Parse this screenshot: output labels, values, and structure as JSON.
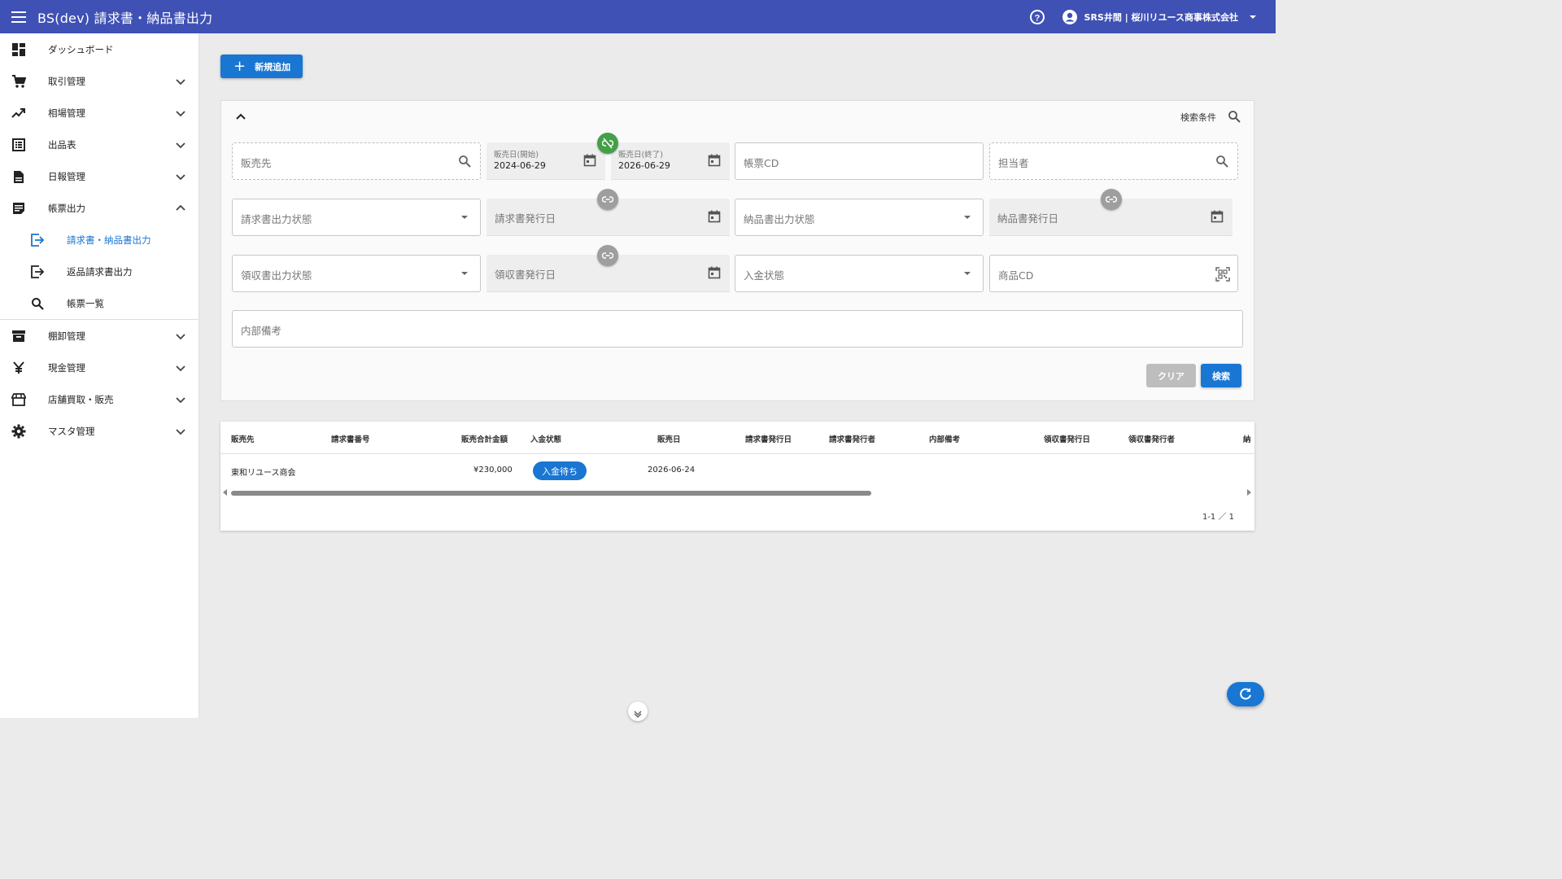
{
  "header": {
    "title": "BS(dev) 請求書・納品書出力",
    "user": "SRS井間 | 桜川リユース商事株式会社"
  },
  "sidebar": {
    "items": [
      {
        "label": "ダッシュボード",
        "icon": "dashboard-icon"
      },
      {
        "label": "取引管理",
        "icon": "cart-icon"
      },
      {
        "label": "相場管理",
        "icon": "trending-up-icon"
      },
      {
        "label": "出品表",
        "icon": "list-icon"
      },
      {
        "label": "日報管理",
        "icon": "document-icon"
      },
      {
        "label": "帳票出力",
        "icon": "form-icon"
      },
      {
        "label": "棚卸管理",
        "icon": "archive-icon"
      },
      {
        "label": "現金管理",
        "icon": "yen-icon"
      },
      {
        "label": "店舗買取・販売",
        "icon": "store-icon"
      },
      {
        "label": "マスタ管理",
        "icon": "gear-icon"
      }
    ],
    "subitems": [
      {
        "label": "請求書・納品書出力",
        "icon": "export-icon"
      },
      {
        "label": "返品請求書出力",
        "icon": "export-icon"
      },
      {
        "label": "帳票一覧",
        "icon": "search-icon"
      }
    ]
  },
  "toolbar": {
    "add_label": "新規追加"
  },
  "search": {
    "condition_label": "検索条件",
    "customer_placeholder": "販売先",
    "sale_date_start_label": "販売日(開始)",
    "sale_date_start_value": "2024-06-29",
    "sale_date_end_label": "販売日(終了)",
    "sale_date_end_value": "2026-06-29",
    "form_cd_placeholder": "帳票CD",
    "staff_placeholder": "担当者",
    "invoice_status_placeholder": "請求書出力状態",
    "invoice_issue_date_placeholder": "請求書発行日",
    "delivery_status_placeholder": "納品書出力状態",
    "delivery_issue_date_placeholder": "納品書発行日",
    "receipt_status_placeholder": "領収書出力状態",
    "receipt_issue_date_placeholder": "領収書発行日",
    "payment_status_placeholder": "入金状態",
    "product_cd_placeholder": "商品CD",
    "memo_placeholder": "内部備考",
    "clear_label": "クリア",
    "search_label": "検索"
  },
  "table": {
    "columns": [
      "販売先",
      "請求書番号",
      "販売合計金額",
      "入金状態",
      "販売日",
      "請求書発行日",
      "請求書発行者",
      "内部備考",
      "領収書発行日",
      "領収書発行者",
      "納"
    ],
    "rows": [
      {
        "customer": "東和リユース商会",
        "invoice_no": "",
        "total": "¥230,000",
        "payment_status": "入金待ち",
        "sale_date": "2026-06-24"
      }
    ],
    "pagination": "1-1 ／ 1"
  },
  "colors": {
    "appbar": "#3f51b5",
    "primary": "#1976d2",
    "link_active": "#43a047",
    "link_inactive": "#9e9e9e"
  }
}
